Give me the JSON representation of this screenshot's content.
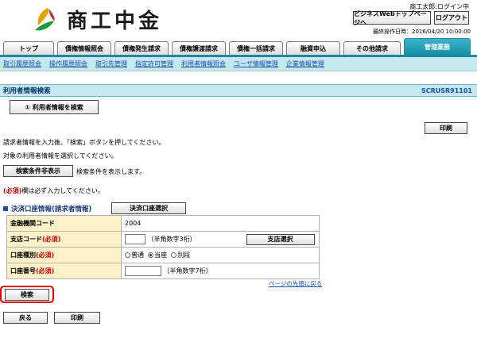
{
  "header": {
    "brand": "商工中金",
    "user": "商工太郎:ログイン中",
    "web_top_button": "ビジネスWebトップページへ",
    "logout_button": "ログアウト",
    "last_operation": "最終操作日時：2016/04/20 10:00:00"
  },
  "tabs": [
    {
      "label": "トップ"
    },
    {
      "label": "債権情報照会"
    },
    {
      "label": "債権発生請求"
    },
    {
      "label": "債権譲渡請求"
    },
    {
      "label": "債権一括請求"
    },
    {
      "label": "融資申込"
    },
    {
      "label": "その他請求"
    },
    {
      "label": "管理業務"
    }
  ],
  "submenu": [
    {
      "label": "取引履歴照会"
    },
    {
      "label": "操作履歴照会"
    },
    {
      "label": "取引先管理"
    },
    {
      "label": "指定許可管理"
    },
    {
      "label": "利用者情報照会"
    },
    {
      "label": "ユーザ情報管理"
    },
    {
      "label": "企業情報管理"
    }
  ],
  "page": {
    "title": "利用者情報検索",
    "screen_id": "SCRUSR91101",
    "step_label": "① 利用者情報を検索",
    "print_button": "印刷",
    "instruction_1": "請求者情報を入力後、「検索」ボタンを押してください。",
    "instruction_2": "対象の利用者情報を選択してください。",
    "toggle_button": "検索条件非表示",
    "toggle_note": "検索条件を表示します。",
    "required_mark": "(必須)",
    "required_note": "欄は必ず入力してください。",
    "section_title": "決済口座情報(請求者情報)",
    "select_account_button": "決済口座選択"
  },
  "form": {
    "bank_code_label": "金融機関コード",
    "bank_code_value": "2004",
    "branch_code_label": "支店コード",
    "branch_code_hint": "（半角数字3桁）",
    "branch_select_button": "支店選択",
    "account_type_label": "口座種別",
    "account_types": [
      "普通",
      "当座",
      "別段"
    ],
    "account_type_selected": "当座",
    "account_number_label": "口座番号",
    "account_number_hint": "（半角数字7桁）"
  },
  "page_top_link": "ページの先頭に戻る",
  "search_button": "検索",
  "back_button": "戻る",
  "bottom_print_button": "印刷",
  "colors": {
    "accent": "#1a8aa0",
    "title_bg": "#c5e8ef",
    "label_bg": "#fdf1c9",
    "required": "#cc0000",
    "highlight": "#e00000"
  }
}
